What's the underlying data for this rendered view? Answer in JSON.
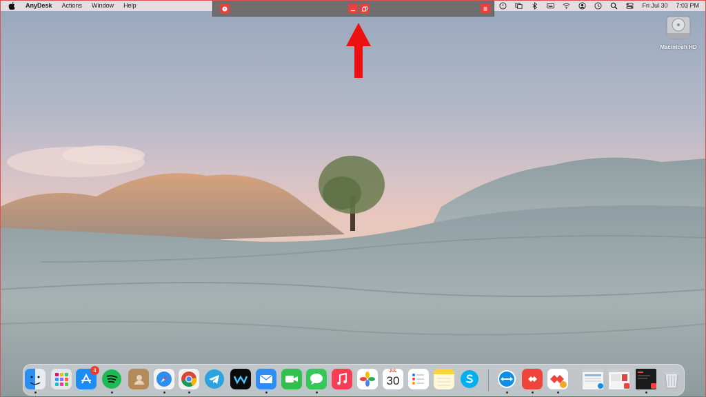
{
  "menubar": {
    "app_name": "AnyDesk",
    "menus": [
      "Actions",
      "Window",
      "Help"
    ],
    "clock_date": "Fri Jul 30",
    "clock_time": "7:03 PM",
    "status_icons": [
      "teamviewer-icon",
      "anydesk-status-icon",
      "screens-icon",
      "bluetooth-icon",
      "keyboard-icon",
      "wifi-icon",
      "user-icon",
      "time-machine-icon",
      "search-icon",
      "control-center-icon"
    ]
  },
  "anydesk_toolbar": {
    "buttons": [
      "session-info-icon",
      "minimize-icon",
      "restore-window-icon",
      "menu-icon"
    ],
    "accent": "#e8403c"
  },
  "desktop": {
    "hd_label": "Macintosh HD"
  },
  "dock": {
    "apps": [
      "Finder",
      "Launchpad",
      "App Store",
      "Spotify",
      "Contacts",
      "Safari",
      "Chrome",
      "Telegram",
      "Webex",
      "Mail",
      "FaceTime",
      "Messages",
      "Music",
      "Photos",
      "Calendar",
      "Reminders",
      "Notes",
      "Skype",
      "TeamViewer",
      "AnyDesk",
      "AnyDesk Alt",
      "Window Preview 1",
      "Window Preview 2",
      "Window Preview 3",
      "Trash"
    ],
    "app_store_badge": "4",
    "calendar_month": "JUL",
    "calendar_day": "30"
  }
}
